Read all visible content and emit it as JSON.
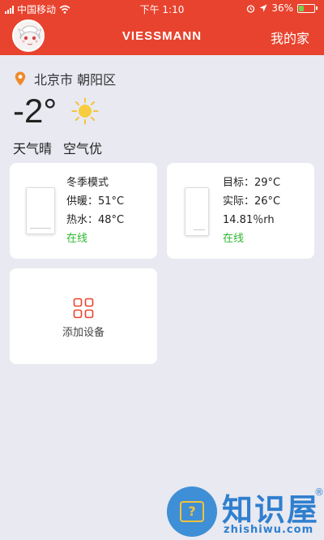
{
  "status_bar": {
    "carrier": "中国移动",
    "time": "下午 1:10",
    "battery": "36%",
    "battery_level": 0.36
  },
  "header": {
    "logo_text": "VIESSMANN",
    "my_home": "我的家",
    "accent_color": "#e8432e"
  },
  "weather": {
    "location": "北京市 朝阳区",
    "temperature": "-2°",
    "condition": "天气晴",
    "air_quality": "空气优"
  },
  "devices": [
    {
      "mode": "冬季模式",
      "heating": "供暖：51°C",
      "hot_water": "热水：48°C",
      "status": "在线"
    },
    {
      "target": "目标：29°C",
      "actual": "实际：26°C",
      "humidity": "14.81％rh",
      "status": "在线"
    }
  ],
  "add_device": {
    "label": "添加设备"
  },
  "watermark": {
    "name": "知识屋",
    "reg": "®",
    "url": "zhishiwu.com"
  },
  "colors": {
    "online": "#2db82d",
    "background": "#e8e9f1"
  }
}
